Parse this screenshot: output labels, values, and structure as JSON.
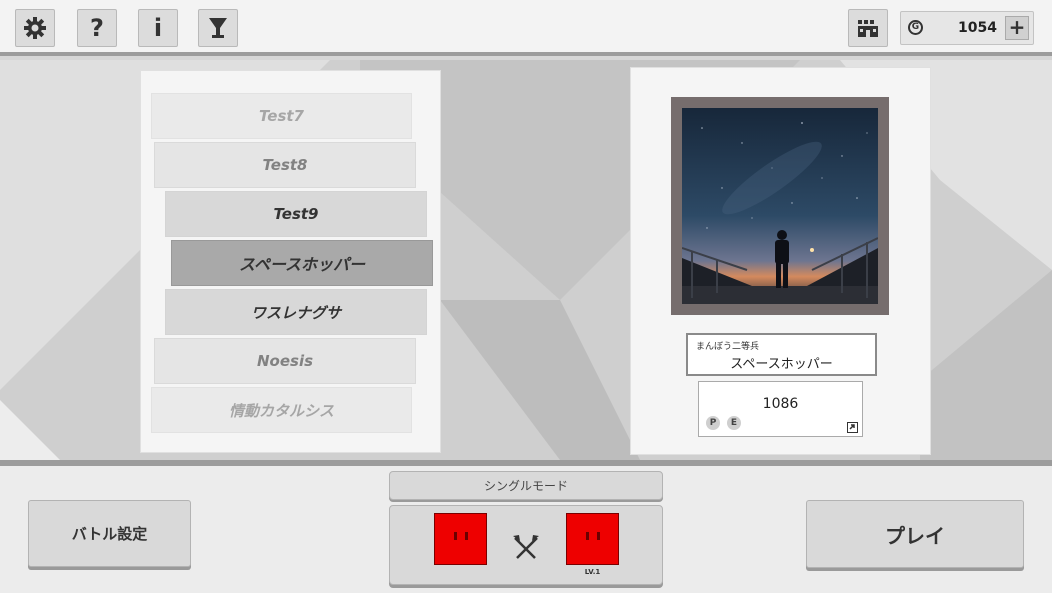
{
  "toolbar": {
    "settings_icon": "gear-icon",
    "help_label": "?",
    "info_label": "i",
    "trophy_icon": "trophy-icon",
    "shop_icon": "shop-icon",
    "coin_symbol": "G",
    "coin_amount": "1054",
    "add_label": "+"
  },
  "song_list": [
    {
      "title": "Test7"
    },
    {
      "title": "Test8"
    },
    {
      "title": "Test9"
    },
    {
      "title": "スペースホッパー"
    },
    {
      "title": "ワスレナグサ"
    },
    {
      "title": "Noesis"
    },
    {
      "title": "情動カタルシス"
    }
  ],
  "selected_song": {
    "artist": "まんぼう二等兵",
    "title": "スペースホッパー",
    "score": "1086",
    "badge_p": "P",
    "badge_e": "E"
  },
  "bottom": {
    "battle_settings_label": "バトル設定",
    "mode_label": "シングルモード",
    "player2_level": "LV.1",
    "play_label": "プレイ"
  },
  "colors": {
    "accent_red": "#ee0000",
    "frame": "#766d6d"
  }
}
